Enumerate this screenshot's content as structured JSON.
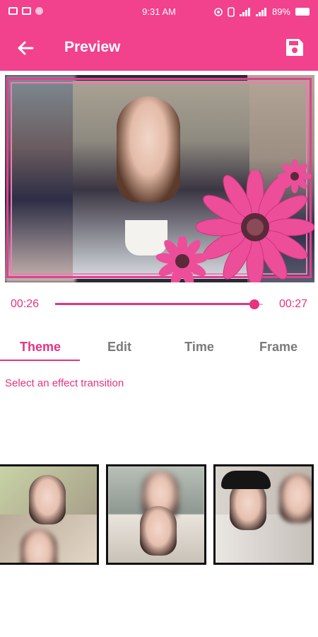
{
  "status_bar": {
    "time": "9:31 AM",
    "battery": "89%",
    "icons": [
      "image-icon",
      "gallery-icon",
      "notification-dot-icon",
      "sync-icon",
      "phone-icon",
      "signal-icon",
      "signal-icon",
      "battery-icon"
    ]
  },
  "app_bar": {
    "title": "Preview",
    "back_icon": "arrow-back-icon",
    "save_icon": "save-icon",
    "color": "#f2418d"
  },
  "player": {
    "current_time": "00:26",
    "total_time": "00:27",
    "progress": 0.96,
    "accent": "#e8327f"
  },
  "tabs": [
    {
      "label": "Theme",
      "active": true
    },
    {
      "label": "Edit",
      "active": false
    },
    {
      "label": "Time",
      "active": false
    },
    {
      "label": "Frame",
      "active": false
    }
  ],
  "hint": "Select an effect transition",
  "transitions": [
    {
      "name": "transition-1"
    },
    {
      "name": "transition-2"
    },
    {
      "name": "transition-3"
    }
  ]
}
